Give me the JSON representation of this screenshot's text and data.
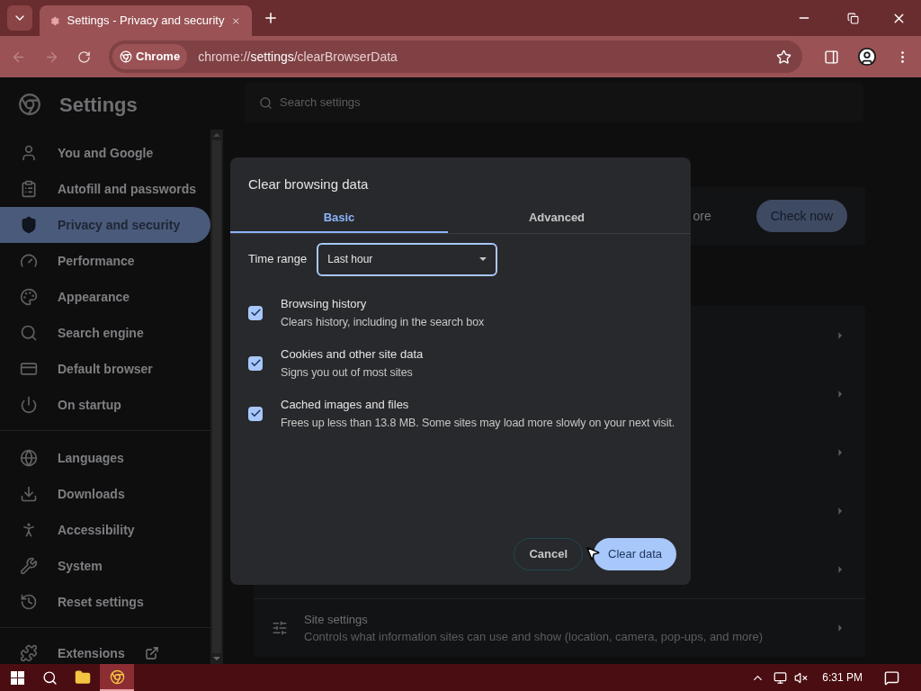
{
  "browser": {
    "tab_title": "Settings - Privacy and security",
    "omnibox_chip": "Chrome",
    "url_host": "chrome://",
    "url_bold": "settings",
    "url_path": "/clearBrowserData"
  },
  "settings": {
    "title": "Settings",
    "search_placeholder": "Search settings",
    "sidebar": [
      {
        "label": "You and Google",
        "selected": false
      },
      {
        "label": "Autofill and passwords",
        "selected": false
      },
      {
        "label": "Privacy and security",
        "selected": true
      },
      {
        "label": "Performance",
        "selected": false
      },
      {
        "label": "Appearance",
        "selected": false
      },
      {
        "label": "Search engine",
        "selected": false
      },
      {
        "label": "Default browser",
        "selected": false
      },
      {
        "label": "On startup",
        "selected": false
      },
      {
        "label": "Languages",
        "selected": false
      },
      {
        "label": "Downloads",
        "selected": false
      },
      {
        "label": "Accessibility",
        "selected": false
      },
      {
        "label": "System",
        "selected": false
      },
      {
        "label": "Reset settings",
        "selected": false
      },
      {
        "label": "Extensions",
        "selected": false
      }
    ],
    "safety_card": {
      "text": "ore",
      "button": "Check now"
    },
    "site_settings": {
      "title": "Site settings",
      "description": "Controls what information sites can use and show (location, camera, pop-ups, and more)"
    }
  },
  "dialog": {
    "title": "Clear browsing data",
    "tabs": [
      {
        "label": "Basic",
        "selected": true
      },
      {
        "label": "Advanced",
        "selected": false
      }
    ],
    "time_range_label": "Time range",
    "time_range_value": "Last hour",
    "options": [
      {
        "title": "Browsing history",
        "description": "Clears history, including in the search box",
        "checked": true
      },
      {
        "title": "Cookies and other site data",
        "description": "Signs you out of most sites",
        "checked": true
      },
      {
        "title": "Cached images and files",
        "description": "Frees up less than 13.8 MB. Some sites may load more slowly on your next visit.",
        "checked": true
      }
    ],
    "cancel": "Cancel",
    "confirm": "Clear data"
  },
  "taskbar": {
    "time": "6:31 PM"
  }
}
